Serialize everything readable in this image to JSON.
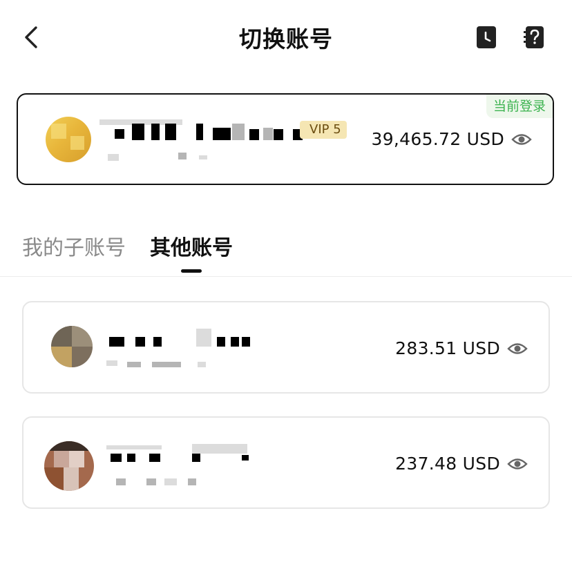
{
  "header": {
    "title": "切换账号",
    "back_icon": "chevron-left-icon",
    "history_icon": "history-clock-icon",
    "help_icon": "help-question-icon"
  },
  "current_account": {
    "badge": "当前登录",
    "vip": "VIP 5",
    "balance": "39,465.72 USD",
    "eye_icon": "eye-icon"
  },
  "tabs": [
    {
      "label": "我的子账号",
      "active": false
    },
    {
      "label": "其他账号",
      "active": true
    }
  ],
  "accounts": [
    {
      "balance": "283.51 USD",
      "eye_icon": "eye-icon"
    },
    {
      "balance": "237.48 USD",
      "eye_icon": "eye-icon"
    }
  ],
  "colors": {
    "current_badge_text": "#3cb34f",
    "current_badge_bg": "#eef7ec",
    "vip_badge_bg": "#f5e6b3",
    "inactive_tab": "#8a8a8a",
    "card_border": "#e6e6e6"
  }
}
